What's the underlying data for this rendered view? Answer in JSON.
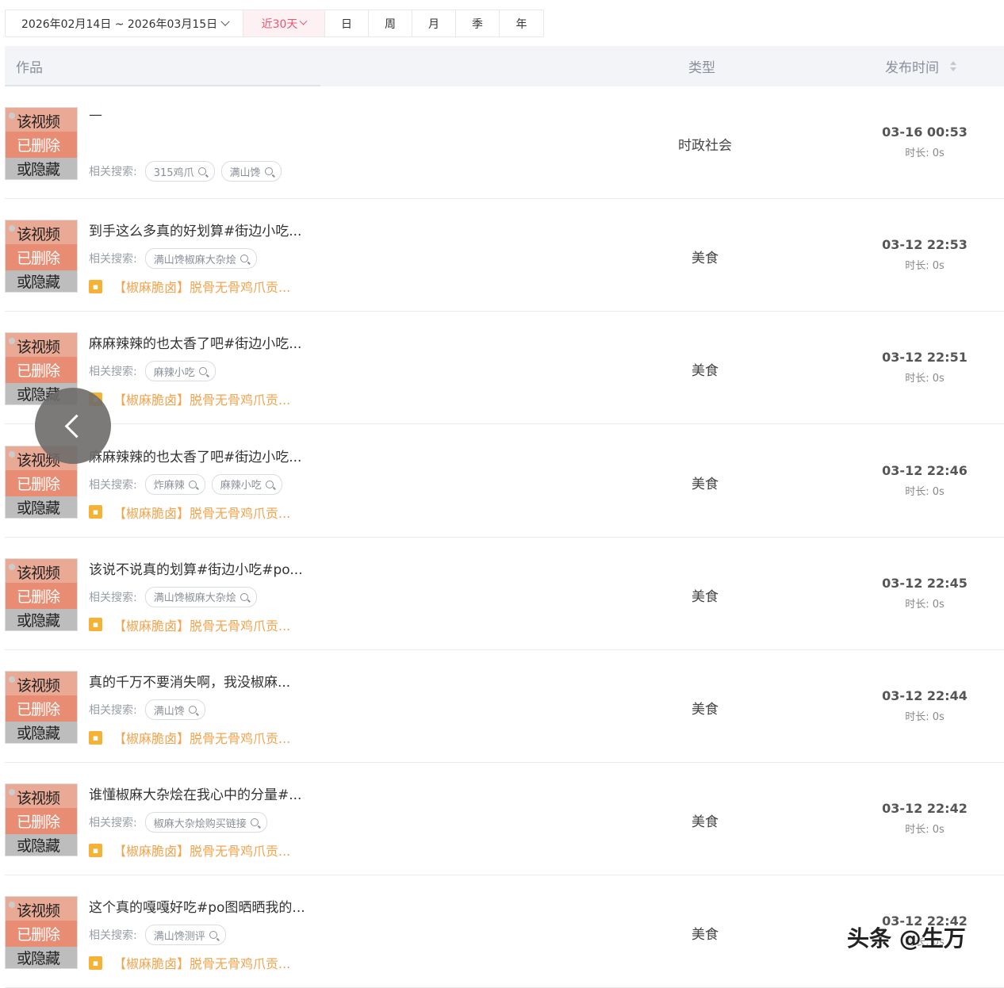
{
  "date_range": {
    "label": "2026年02月14日 ~ 2026年03月15日"
  },
  "period_tabs": [
    {
      "label": "近30天"
    },
    {
      "label": "日"
    },
    {
      "label": "周"
    },
    {
      "label": "月"
    },
    {
      "label": "季"
    },
    {
      "label": "年"
    }
  ],
  "table_header": {
    "work": "作品",
    "type": "类型",
    "publish_time": "发布时间"
  },
  "thumbnail_text": {
    "line1": "该视频",
    "line2": "已删除",
    "line3": "或隐藏"
  },
  "search_label": "相关搜索:",
  "rows": [
    {
      "title": "—",
      "tags": [
        "315鸡爪",
        "满山馋"
      ],
      "product": "",
      "type": "时政社会",
      "date": "03-16 00:53",
      "duration": "时长: 0s"
    },
    {
      "title": "到手这么多真的好划算#街边小吃...",
      "tags": [
        "满山馋椒麻大杂烩"
      ],
      "product": "【椒麻脆卤】脱骨无骨鸡爪贡...",
      "type": "美食",
      "date": "03-12 22:53",
      "duration": "时长: 0s"
    },
    {
      "title": "麻麻辣辣的也太香了吧#街边小吃...",
      "tags": [
        "麻辣小吃"
      ],
      "product": "【椒麻脆卤】脱骨无骨鸡爪贡...",
      "type": "美食",
      "date": "03-12 22:51",
      "duration": "时长: 0s"
    },
    {
      "title": "麻麻辣辣的也太香了吧#街边小吃...",
      "tags": [
        "炸麻辣",
        "麻辣小吃"
      ],
      "product": "【椒麻脆卤】脱骨无骨鸡爪贡...",
      "type": "美食",
      "date": "03-12 22:46",
      "duration": "时长: 0s"
    },
    {
      "title": "该说不说真的划算#街边小吃#po...",
      "tags": [
        "满山馋椒麻大杂烩"
      ],
      "product": "【椒麻脆卤】脱骨无骨鸡爪贡...",
      "type": "美食",
      "date": "03-12 22:45",
      "duration": "时长: 0s"
    },
    {
      "title": "真的千万不要消失啊，我没椒麻...",
      "tags": [
        "满山馋"
      ],
      "product": "【椒麻脆卤】脱骨无骨鸡爪贡...",
      "type": "美食",
      "date": "03-12 22:44",
      "duration": "时长: 0s"
    },
    {
      "title": "谁懂椒麻大杂烩在我心中的分量#...",
      "tags": [
        "椒麻大杂烩购买链接"
      ],
      "product": "【椒麻脆卤】脱骨无骨鸡爪贡...",
      "type": "美食",
      "date": "03-12 22:42",
      "duration": "时长: 0s"
    },
    {
      "title": "这个真的嘎嘎好吃#po图晒晒我的...",
      "tags": [
        "满山馋测评"
      ],
      "product": "【椒麻脆卤】脱骨无骨鸡爪贡...",
      "type": "美食",
      "date": "03-12 22:42",
      "duration": "时长: 0s"
    }
  ],
  "watermark": "头条 @生万"
}
